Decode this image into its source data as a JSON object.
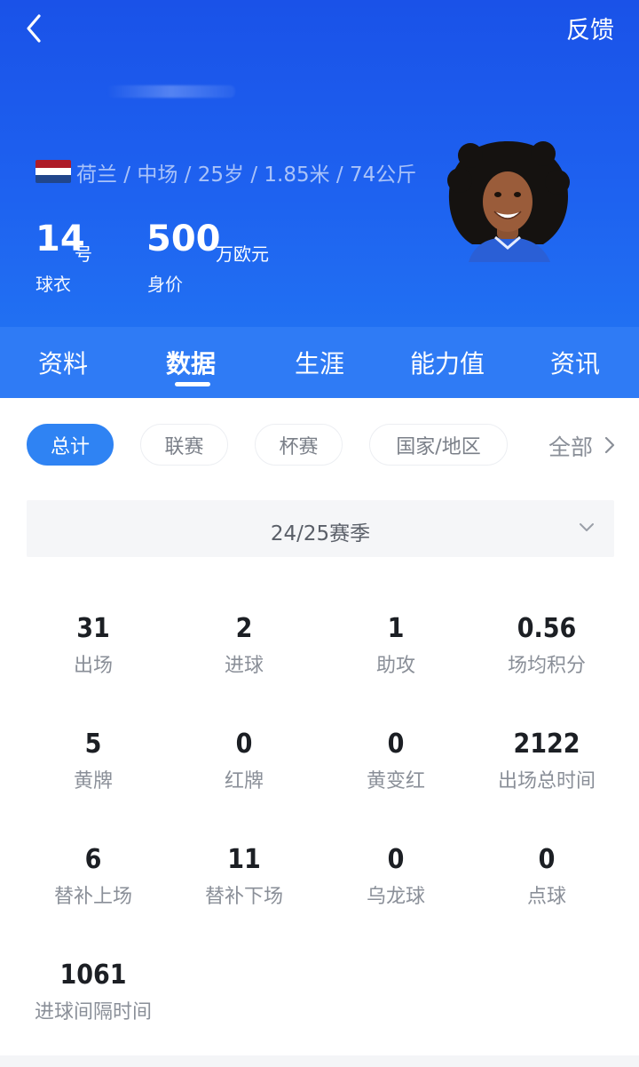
{
  "header": {
    "feedback_label": "反馈",
    "meta": "荷兰 / 中场 / 25岁 / 1.85米 / 74公斤",
    "flag_colors": [
      "#ae1c28",
      "#ffffff",
      "#21468b"
    ],
    "jersey": {
      "number": "14",
      "unit": "号",
      "label": "球衣"
    },
    "market_value": {
      "number": "500",
      "unit": "万欧元",
      "label": "身价"
    }
  },
  "tabs": [
    "资料",
    "数据",
    "生涯",
    "能力值",
    "资讯"
  ],
  "active_tab": "数据",
  "filters": [
    "总计",
    "联赛",
    "杯赛",
    "国家/地区"
  ],
  "active_filter": "总计",
  "filter_all_label": "全部",
  "season": "24/25赛季",
  "stats": [
    {
      "value": "31",
      "label": "出场"
    },
    {
      "value": "2",
      "label": "进球"
    },
    {
      "value": "1",
      "label": "助攻"
    },
    {
      "value": "0.56",
      "label": "场均积分"
    },
    {
      "value": "5",
      "label": "黄牌"
    },
    {
      "value": "0",
      "label": "红牌"
    },
    {
      "value": "0",
      "label": "黄变红"
    },
    {
      "value": "2122",
      "label": "出场总时间"
    },
    {
      "value": "6",
      "label": "替补上场"
    },
    {
      "value": "11",
      "label": "替补下场"
    },
    {
      "value": "0",
      "label": "乌龙球"
    },
    {
      "value": "0",
      "label": "点球"
    },
    {
      "value": "1061",
      "label": "进球间隔时间"
    }
  ],
  "colors": {
    "header_blue": "#1e62f0",
    "tab_blue": "#2f7bf5",
    "chip_active": "#2f83f3"
  }
}
